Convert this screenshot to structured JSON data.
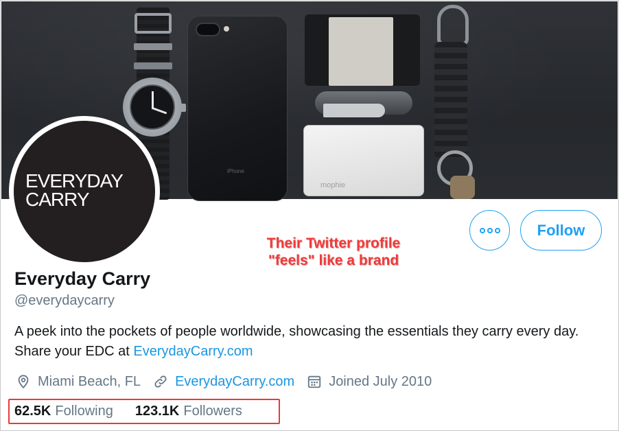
{
  "profile": {
    "display_name": "Everyday Carry",
    "handle": "@everydaycarry",
    "bio_text": "A peek into the pockets of people worldwide, showcasing the essentials they carry every day. Share your EDC at ",
    "bio_link": "EverydayCarry.com",
    "location": "Miami Beach, FL",
    "website": "EverydayCarry.com",
    "joined": "Joined July 2010"
  },
  "avatar": {
    "line1": "EVERYDAY",
    "line2": "CARRY"
  },
  "banner": {
    "phone_label": "iPhone",
    "powerbank_label": "mophie"
  },
  "actions": {
    "follow_label": "Follow"
  },
  "stats": {
    "following_count": "62.5K",
    "following_label": "Following",
    "followers_count": "123.1K",
    "followers_label": "Followers"
  },
  "annotation": {
    "line1": "Their Twitter profile",
    "line2": "\"feels\" like a brand"
  },
  "colors": {
    "accent": "#1da1f2",
    "link": "#1b95e0",
    "annotation": "#f03a3a",
    "highlight_box": "#e63b3b",
    "muted_text": "#657786"
  }
}
